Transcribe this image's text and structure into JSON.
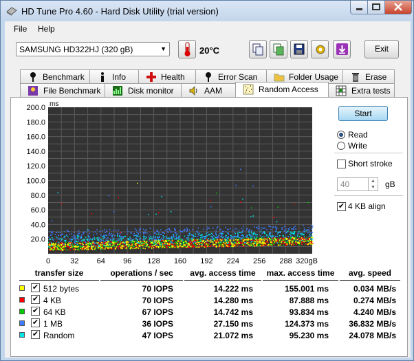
{
  "window": {
    "title": "HD Tune Pro 4.60 - Hard Disk Utility (trial version)"
  },
  "menu": [
    "File",
    "Help"
  ],
  "toolbar": {
    "drive": "SAMSUNG HD322HJ (320 gB)",
    "temperature": "20°C",
    "exit_label": "Exit",
    "icons": [
      "copy-info-icon",
      "copy-screenshot-icon",
      "save-icon",
      "options-icon",
      "download-icon"
    ]
  },
  "tabs_row1": [
    {
      "label": "Benchmark",
      "icon": "benchmark-icon"
    },
    {
      "label": "Info",
      "icon": "info-icon"
    },
    {
      "label": "Health",
      "icon": "health-icon"
    },
    {
      "label": "Error Scan",
      "icon": "error-scan-icon"
    },
    {
      "label": "Folder Usage",
      "icon": "folder-icon"
    },
    {
      "label": "Erase",
      "icon": "trash-icon"
    }
  ],
  "tabs_row2": [
    {
      "label": "File Benchmark",
      "icon": "file-benchmark-icon"
    },
    {
      "label": "Disk monitor",
      "icon": "disk-monitor-icon"
    },
    {
      "label": "AAM",
      "icon": "speaker-icon"
    },
    {
      "label": "Random Access",
      "icon": "random-access-icon",
      "active": true
    },
    {
      "label": "Extra tests",
      "icon": "extra-tests-icon"
    }
  ],
  "controls": {
    "start_label": "Start",
    "read_label": "Read",
    "write_label": "Write",
    "selected_mode": "Read",
    "short_stroke_label": "Short stroke",
    "short_stroke_checked": false,
    "short_stroke_value": "40",
    "short_stroke_unit": "gB",
    "align_label": "4 KB align",
    "align_checked": true
  },
  "chart_data": {
    "type": "scatter",
    "ylabel": "ms",
    "ylim": [
      0,
      200
    ],
    "yticks": [
      "200.0",
      "180.0",
      "160.0",
      "140.0",
      "120.0",
      "100.0",
      "80.0",
      "60.0",
      "40.0",
      "20.0"
    ],
    "xlim": [
      0,
      320
    ],
    "xticks": [
      "0",
      "32",
      "64",
      "96",
      "128",
      "160",
      "192",
      "224",
      "256",
      "288",
      "320gB"
    ],
    "grid": true,
    "background": "#333333",
    "series": [
      {
        "name": "512 bytes",
        "color": "#ffff00",
        "avg_ms": 14.222,
        "max_ms": 155.001
      },
      {
        "name": "4 KB",
        "color": "#ff0000",
        "avg_ms": 14.28,
        "max_ms": 87.888
      },
      {
        "name": "64 KB",
        "color": "#00cc00",
        "avg_ms": 14.742,
        "max_ms": 93.834
      },
      {
        "name": "1 MB",
        "color": "#3b7bff",
        "avg_ms": 27.15,
        "max_ms": 124.373
      },
      {
        "name": "Random",
        "color": "#00e5e5",
        "avg_ms": 21.072,
        "max_ms": 95.23
      }
    ]
  },
  "table": {
    "headers": [
      "transfer size",
      "operations / sec",
      "avg. access time",
      "max. access time",
      "avg. speed"
    ],
    "rows": [
      {
        "name": "512 bytes",
        "color": "#ffff00",
        "checked": true,
        "ops": "70 IOPS",
        "avg": "14.222 ms",
        "max": "155.001 ms",
        "speed": "0.034 MB/s"
      },
      {
        "name": "4 KB",
        "color": "#ff0000",
        "checked": true,
        "ops": "70 IOPS",
        "avg": "14.280 ms",
        "max": "87.888 ms",
        "speed": "0.274 MB/s"
      },
      {
        "name": "64 KB",
        "color": "#00cc00",
        "checked": true,
        "ops": "67 IOPS",
        "avg": "14.742 ms",
        "max": "93.834 ms",
        "speed": "4.240 MB/s"
      },
      {
        "name": "1 MB",
        "color": "#3b7bff",
        "checked": true,
        "ops": "36 IOPS",
        "avg": "27.150 ms",
        "max": "124.373 ms",
        "speed": "36.832 MB/s"
      },
      {
        "name": "Random",
        "color": "#00e5e5",
        "checked": true,
        "ops": "47 IOPS",
        "avg": "21.072 ms",
        "max": "95.230 ms",
        "speed": "24.078 MB/s"
      }
    ]
  }
}
